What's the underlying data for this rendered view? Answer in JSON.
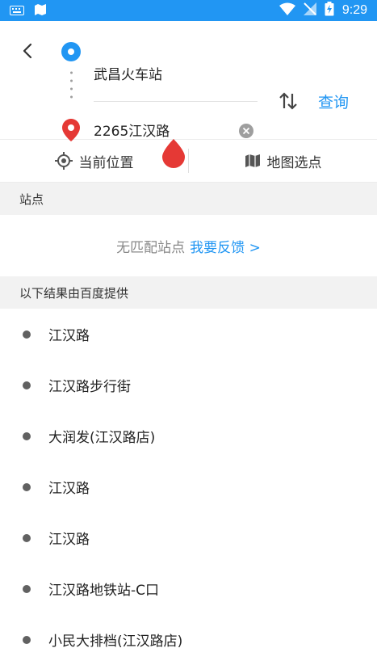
{
  "status_bar": {
    "time": "9:29"
  },
  "route": {
    "origin": "武昌火车站",
    "destination": "2265江汉路",
    "query_label": "查询"
  },
  "location_buttons": {
    "current": "当前位置",
    "map_select": "地图选点"
  },
  "stations": {
    "header": "站点",
    "no_match": "无匹配站点",
    "feedback_link": "我要反馈 >"
  },
  "results": {
    "header": "以下结果由百度提供",
    "items": [
      "江汉路",
      "江汉路步行街",
      "大润发(江汉路店)",
      "江汉路",
      "江汉路",
      "江汉路地铁站-C口",
      "小民大排档(江汉路店)"
    ]
  },
  "colors": {
    "accent": "#2196f3",
    "pin": "#e53935"
  }
}
